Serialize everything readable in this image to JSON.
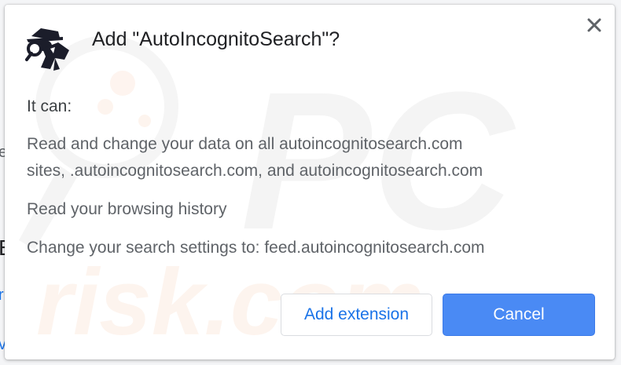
{
  "dialog": {
    "title": "Add \"AutoIncognitoSearch\"?",
    "intro": "It can:",
    "permissions": [
      {
        "line1": "Read and change your data on all autoincognitosearch.com",
        "line2": "sites, .autoincognitosearch.com, and autoincognitosearch.com"
      },
      {
        "line1": "Read your browsing history"
      },
      {
        "line1": "Change your search settings to: feed.autoincognitosearch.com"
      }
    ],
    "add_label": "Add extension",
    "cancel_label": "Cancel",
    "extension_icon": "spy-agent-icon",
    "close_icon": "close-icon"
  },
  "colors": {
    "accent": "#1a73e8",
    "primary_button": "#4a8af4",
    "text_primary": "#202124",
    "text_secondary": "#5f6368"
  }
}
